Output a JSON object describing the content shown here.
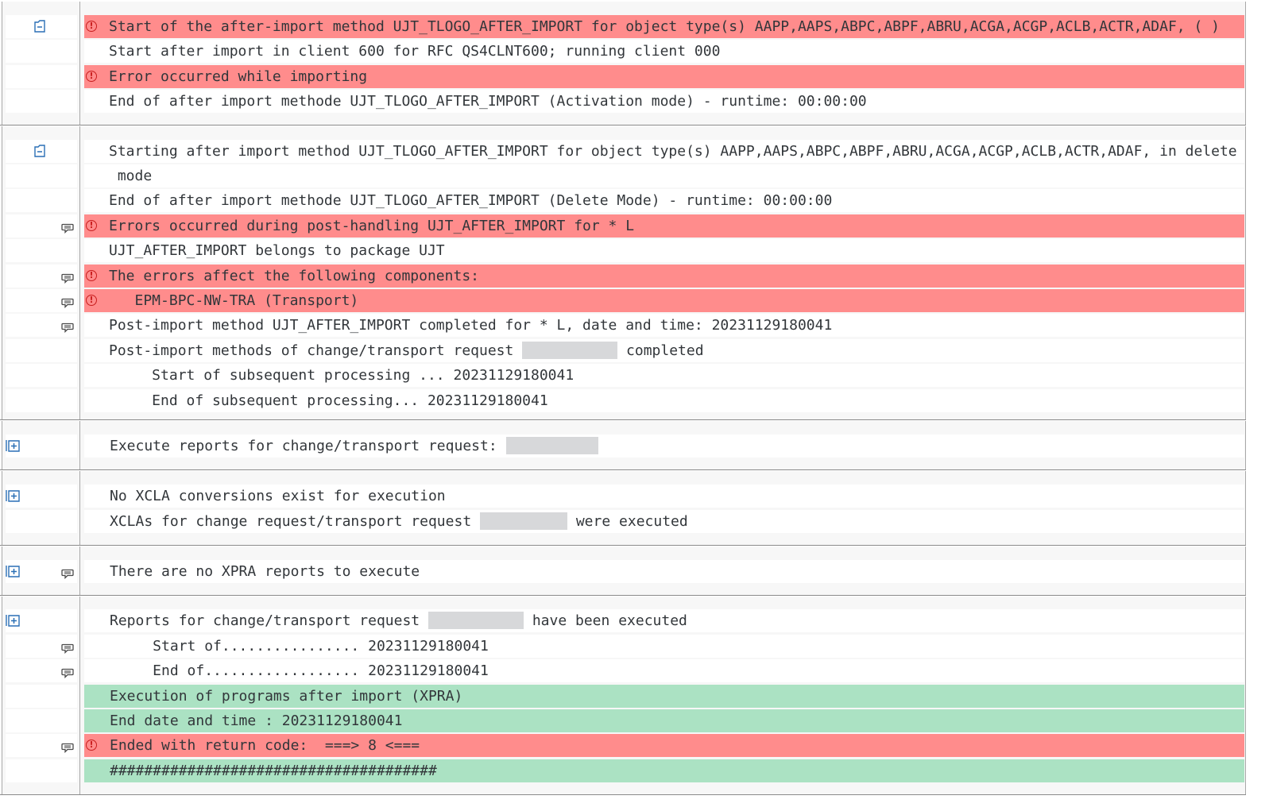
{
  "sections": [
    {
      "id": "s1",
      "node_icon": "collapse-node-icon",
      "rows": [
        {
          "status": "error",
          "text": "Start of the after-import method UJT_TLOGO_AFTER_IMPORT for object type(s) AAPP,AAPS,ABPC,ABPF,ABRU,ACGA,ACGP,ACLB,ACTR,ADAF, ( )"
        },
        {
          "status": "none",
          "text": "Start after import in client 600 for RFC QS4CLNT600; running client 000"
        },
        {
          "status": "error",
          "text": "Error occurred while importing"
        },
        {
          "status": "none",
          "text": "End of after import methode UJT_TLOGO_AFTER_IMPORT (Activation mode) - runtime: 00:00:00"
        }
      ]
    },
    {
      "id": "s2",
      "node_icon": "collapse-node-icon",
      "rows": [
        {
          "status": "none",
          "text": "Starting after import method UJT_TLOGO_AFTER_IMPORT for object type(s) AAPP,AAPS,ABPC,ABPF,ABRU,ACGA,ACGP,ACLB,ACTR,ADAF, in delete"
        },
        {
          "status": "none",
          "text": " mode"
        },
        {
          "status": "none",
          "text": "End of after import methode UJT_TLOGO_AFTER_IMPORT (Delete Mode) - runtime: 00:00:00"
        },
        {
          "status": "error",
          "message_icon": true,
          "text": "Errors occurred during post-handling UJT_AFTER_IMPORT for * L"
        },
        {
          "status": "none",
          "text": "UJT_AFTER_IMPORT belongs to package UJT"
        },
        {
          "status": "error",
          "message_icon": true,
          "text": "The errors affect the following components:"
        },
        {
          "status": "error",
          "message_icon": true,
          "text": "   EPM-BPC-NW-TRA (Transport)"
        },
        {
          "status": "none",
          "message_icon": true,
          "text": "Post-import method UJT_AFTER_IMPORT completed for * L, date and time: 20231129180041"
        },
        {
          "status": "none",
          "text": "Post-import methods of change/transport request",
          "redacted": true,
          "text_after": "completed"
        },
        {
          "status": "none",
          "text": "     Start of subsequent processing ... 20231129180041"
        },
        {
          "status": "none",
          "text": "     End of subsequent processing... 20231129180041"
        }
      ]
    },
    {
      "id": "s3",
      "node_icon": "expand-node-icon",
      "rows": [
        {
          "status": "none",
          "text": "Execute reports for change/transport request:",
          "redacted": true,
          "text_after": ""
        }
      ]
    },
    {
      "id": "s4",
      "node_icon": "expand-node-icon",
      "rows": [
        {
          "status": "none",
          "text": "No XCLA conversions exist for execution"
        },
        {
          "status": "none",
          "text": "XCLAs for change request/transport request",
          "redacted": true,
          "text_after": "were executed"
        }
      ]
    },
    {
      "id": "s5",
      "node_icon": "expand-node-icon",
      "rows": [
        {
          "status": "none",
          "message_icon": true,
          "text": "There are no XPRA reports to execute"
        }
      ]
    },
    {
      "id": "s6",
      "node_icon": "expand-node-icon",
      "rows": [
        {
          "status": "none",
          "text": "Reports for change/transport request",
          "redacted": true,
          "text_after": "have been executed"
        },
        {
          "status": "none",
          "message_icon": true,
          "text": "     Start of................ 20231129180041"
        },
        {
          "status": "none",
          "message_icon": true,
          "text": "     End of.................. 20231129180041"
        },
        {
          "status": "success",
          "text": "Execution of programs after import (XPRA)"
        },
        {
          "status": "success",
          "text": "End date and time : 20231129180041"
        },
        {
          "status": "error",
          "message_icon": true,
          "text": "Ended with return code:  ===> 8 <==="
        },
        {
          "status": "success",
          "text": "######################################"
        }
      ]
    }
  ],
  "colors": {
    "error_row": "#ff8c8c",
    "success_row": "#abe2c3",
    "error_icon": "#c81e1e",
    "node_icon": "#2a6fb5",
    "message_icon": "#4a4a4a"
  }
}
